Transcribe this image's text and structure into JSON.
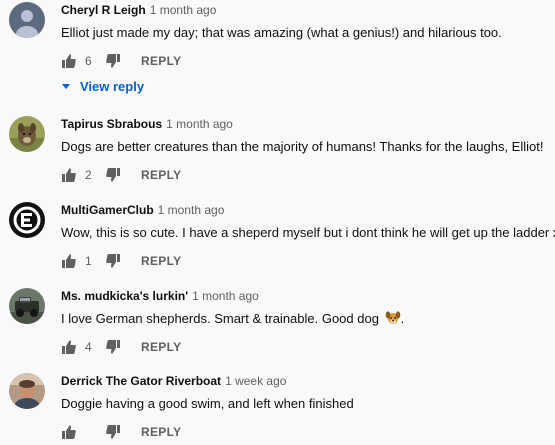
{
  "comments": [
    {
      "author": "Cheryl R Leigh",
      "time": "1 month ago",
      "text": "Elliot just made my day; that was amazing (what a genius!) and hilarious too.",
      "likes": "6",
      "reply_label": "REPLY",
      "view_replies_label": "View reply",
      "avatar_icon": "initial-avatar"
    },
    {
      "author": "Tapirus Sbrabous",
      "time": "1 month ago",
      "text": "Dogs are better creatures than the majority of humans! Thanks for the laughs, Elliot!",
      "likes": "2",
      "reply_label": "REPLY",
      "avatar_icon": "dog-photo-avatar"
    },
    {
      "author": "MultiGamerClub",
      "time": "1 month ago",
      "text": "Wow, this is so cute. I have a sheperd myself but i dont think he will get up the ladder x)",
      "likes": "1",
      "reply_label": "REPLY",
      "avatar_icon": "logo-avatar"
    },
    {
      "author": "Ms. mudkicka's lurkin'",
      "time": "1 month ago",
      "text": "I love German shepherds. Smart &  trainable. Good dog",
      "text_suffix": ".",
      "emoji": "dog-emoji",
      "likes": "4",
      "reply_label": "REPLY",
      "avatar_icon": "truck-photo-avatar"
    },
    {
      "author": "Derrick The Gator Riverboat",
      "time": "1 week ago",
      "text": "Doggie having a good swim, and left when finished",
      "likes": "",
      "reply_label": "REPLY",
      "avatar_icon": "person-photo-avatar"
    }
  ],
  "colors": {
    "background": "#f9f9f9",
    "text": "#0f0f0f",
    "secondary": "#606060",
    "link": "#065fd4"
  }
}
